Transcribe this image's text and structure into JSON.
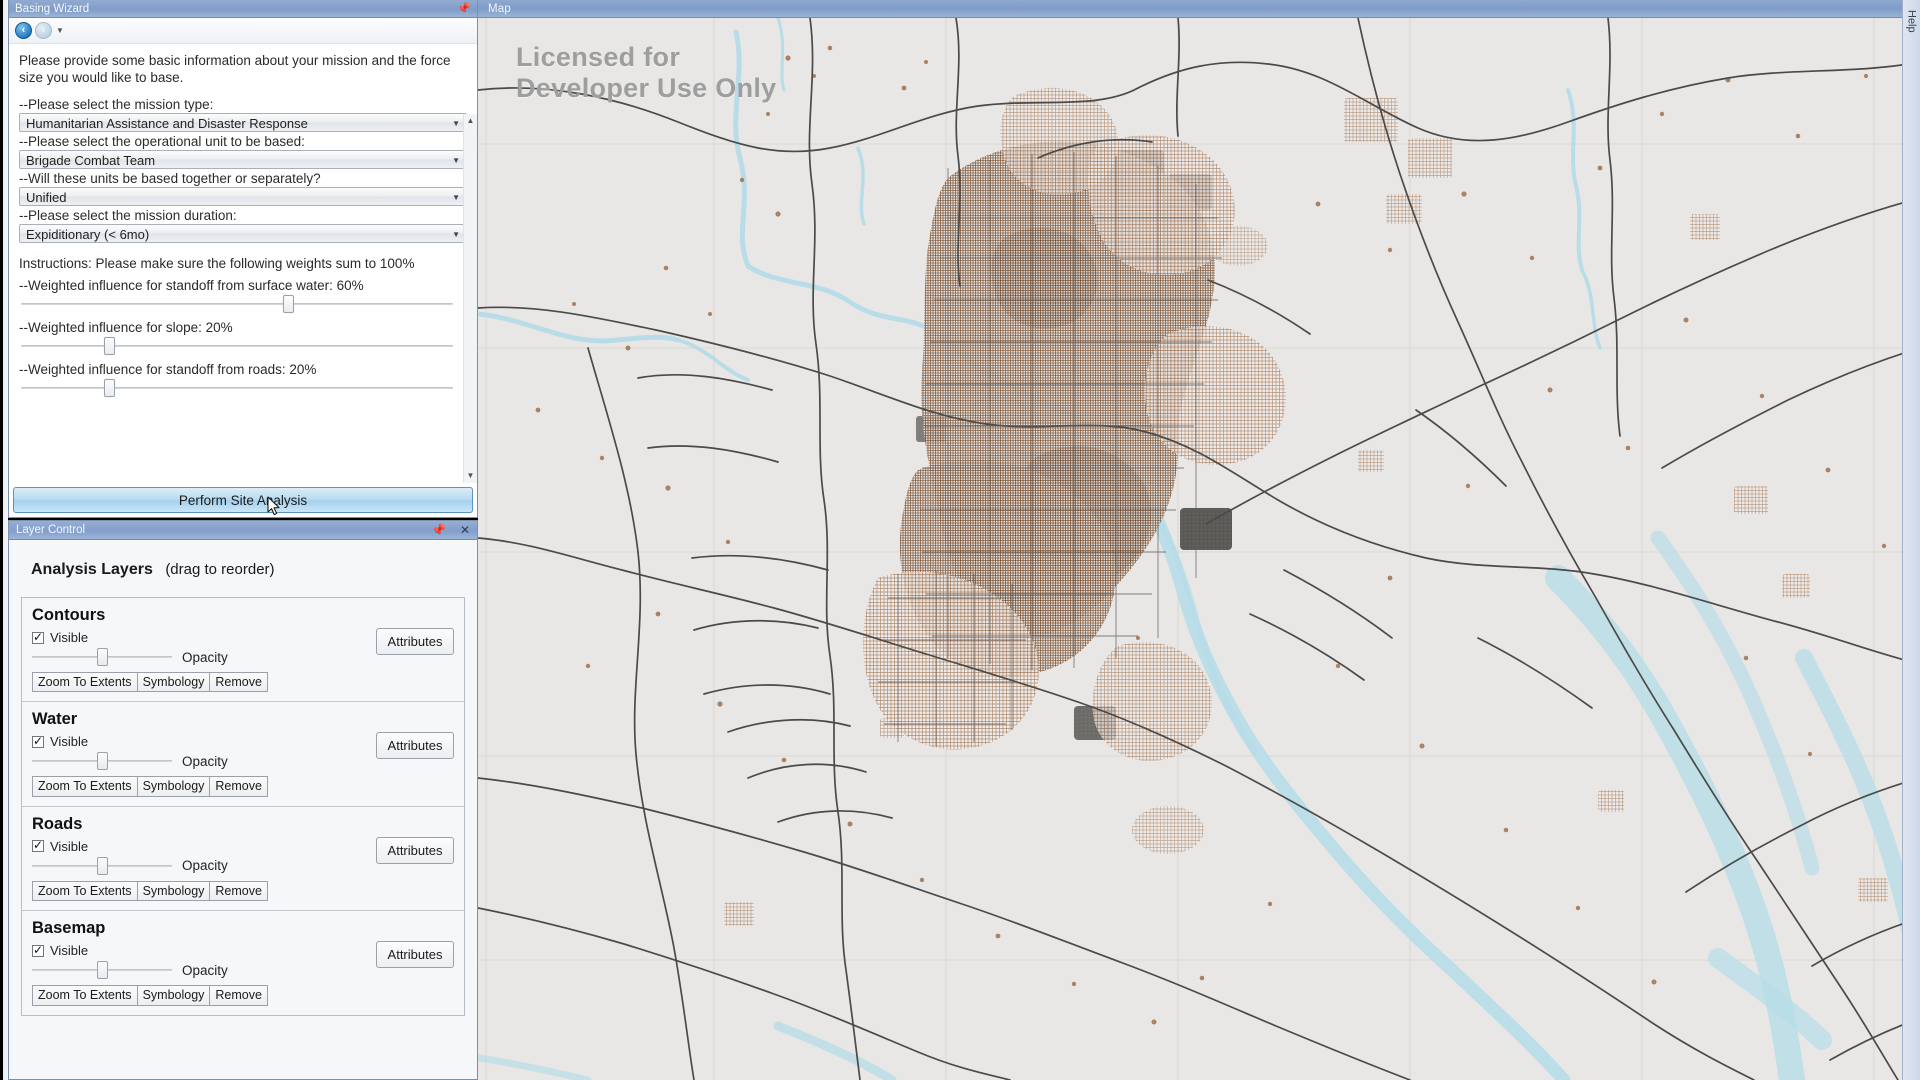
{
  "wizard": {
    "title": "Basing Wizard",
    "pin_icon": "pin-icon",
    "nav": {
      "back_icon": "back-arrow-icon",
      "forward_icon": "forward-arrow-icon",
      "caret_icon": "chevron-down-icon"
    },
    "intro": "Please provide some basic information about your mission and the force size you would like to base.",
    "fields": [
      {
        "label": "--Please select the mission type:",
        "value": "Humanitarian Assistance and Disaster Response"
      },
      {
        "label": "--Please select the operational unit to be based:",
        "value": "Brigade Combat Team"
      },
      {
        "label": "--Will these units be based together or separately?",
        "value": "Unified"
      },
      {
        "label": "--Please select the mission duration:",
        "value": "Expiditionary (< 6mo)"
      }
    ],
    "instructions": "Instructions: Please make sure the following weights sum to 100%",
    "sliders": [
      {
        "label": "--Weighted influence for standoff from surface water: 60%",
        "percent": 60
      },
      {
        "label": "--Weighted influence for slope: 20%",
        "percent": 20
      },
      {
        "label": "--Weighted influence for standoff from roads: 20%",
        "percent": 20
      }
    ],
    "perform_button": "Perform Site Analysis"
  },
  "layer_control": {
    "title": "Layer Control",
    "pin_icon": "pin-icon",
    "close_icon": "close-icon",
    "heading": "Analysis Layers",
    "heading_sub": "(drag to reorder)",
    "visible_label": "Visible",
    "opacity_label": "Opacity",
    "attributes_label": "Attributes",
    "buttons": {
      "zoom": "Zoom To Extents",
      "symbology": "Symbology",
      "remove": "Remove"
    },
    "layers": [
      {
        "name": "Contours",
        "visible": true,
        "opacity": 50
      },
      {
        "name": "Water",
        "visible": true,
        "opacity": 50
      },
      {
        "name": "Roads",
        "visible": true,
        "opacity": 50
      },
      {
        "name": "Basemap",
        "visible": true,
        "opacity": 50
      }
    ]
  },
  "map": {
    "title": "Map",
    "watermark": "Licensed for Developer Use Only",
    "colors": {
      "background": "#e9e7e5",
      "water": "#b8dde8",
      "roads": "#4a4a48",
      "buildings_brown": "#9a6a43",
      "buildings_dark": "#3d3b39",
      "grid": "#d6d3d0"
    }
  },
  "help_panel": {
    "label": "Help"
  }
}
